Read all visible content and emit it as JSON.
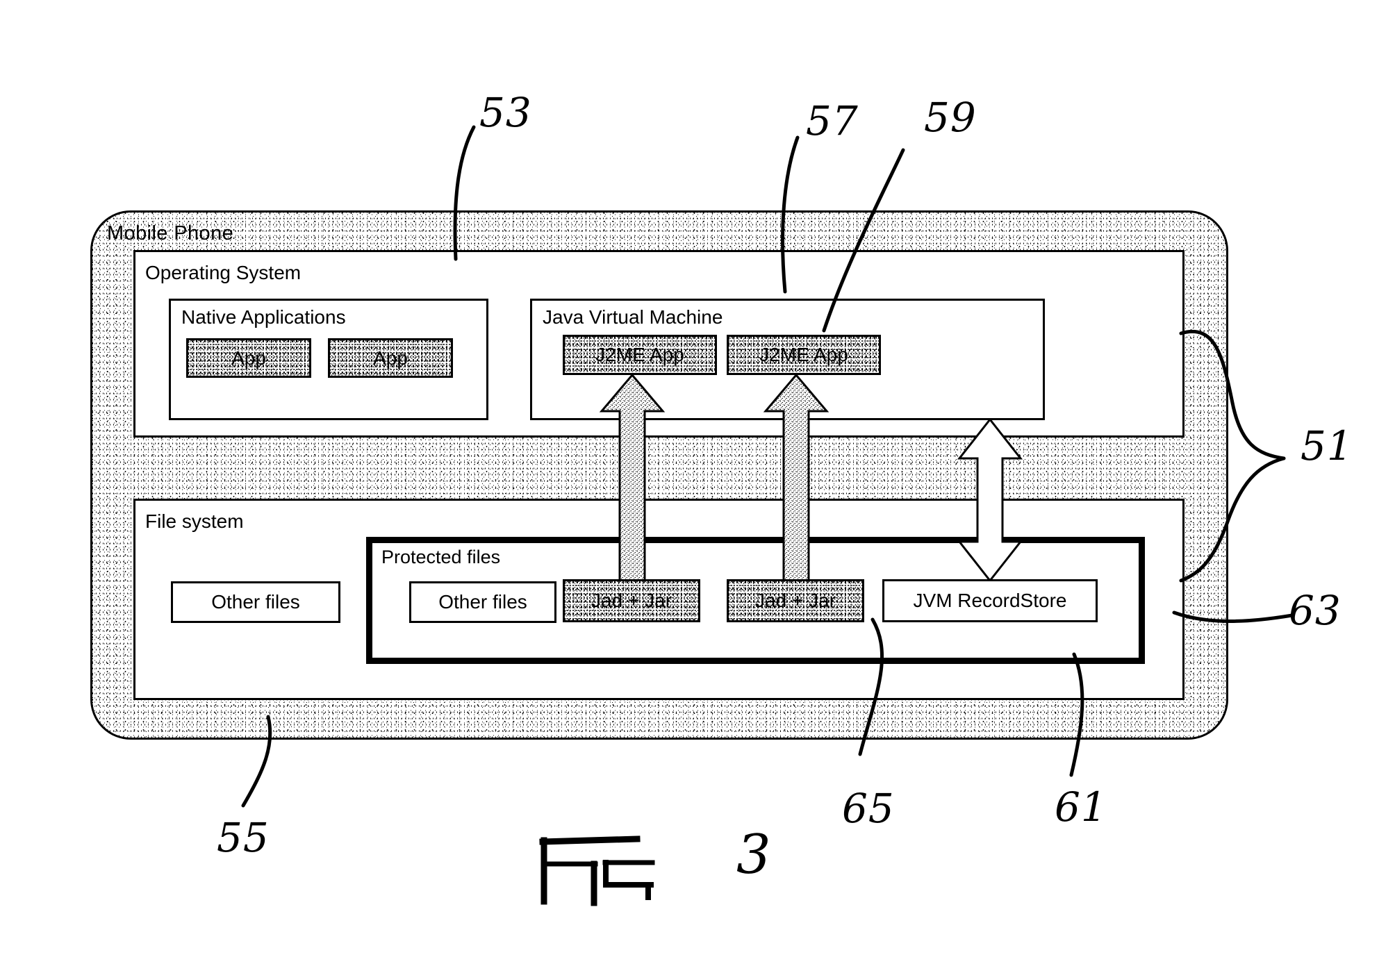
{
  "figure": {
    "caption_label": "FIG",
    "number": "3"
  },
  "diagram": {
    "frame": {
      "label": "Mobile Phone",
      "ref": "51"
    },
    "operating_system": {
      "label": "Operating System",
      "ref": "53",
      "native_applications": {
        "label": "Native Applications",
        "apps": [
          {
            "label": "App"
          },
          {
            "label": "App"
          }
        ]
      },
      "java_virtual_machine": {
        "label": "Java Virtual Machine",
        "ref": "57",
        "apps": [
          {
            "label": "J2ME App",
            "ref": "59"
          },
          {
            "label": "J2ME App"
          }
        ]
      }
    },
    "file_system": {
      "label": "File system",
      "ref": "55",
      "other_files": {
        "label": "Other files"
      },
      "protected_files": {
        "label": "Protected files",
        "ref": "63",
        "items": [
          {
            "label": "Other files"
          },
          {
            "label": "Jad + Jar"
          },
          {
            "label": "Jad + Jar",
            "ref": "65"
          },
          {
            "label": "JVM RecordStore",
            "ref": "61"
          }
        ]
      }
    },
    "refs": {
      "r51": "51",
      "r53": "53",
      "r55": "55",
      "r57": "57",
      "r59": "59",
      "r61": "61",
      "r63": "63",
      "r65": "65"
    }
  }
}
